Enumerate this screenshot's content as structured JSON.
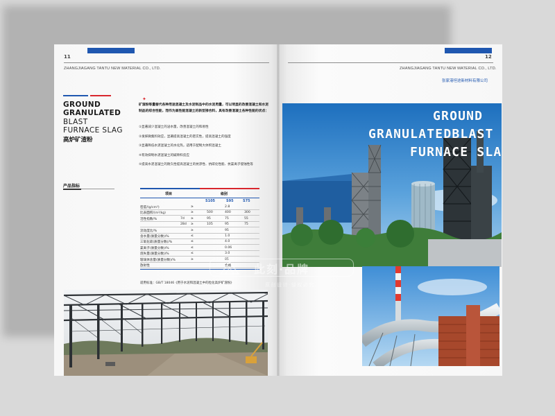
{
  "left_page": {
    "page_number": "11",
    "company_en": "ZHANGJIAGANG TANTU NEW MATERIAL CO., LTD.",
    "title_lines": [
      "GROUND",
      "GRANULATED",
      "BLAST",
      "FURNACE SLAG"
    ],
    "title_cn": "高炉矿渣粉",
    "spec_label": "产品指标",
    "arrow": "✦",
    "intro": "矿渣粉等量替代各种用途混凝土及水泥制品中的水泥用量，可以明显的改善混凝土和水泥制品的综合性能，而作为高性能混凝土的新型掺合料，具有改善混凝土各种性能的优点：",
    "features": [
      "①显著减少混凝土的泌水量，改善混凝土的和易性",
      "②发挥微集料效应，显著提高混凝土的密实性，提高混凝土的强度",
      "③显著降低水泥混凝土的水化热，适用于配制大体积混凝土",
      "④有效抑制水泥混凝土的碱骨料反应",
      "⑤提高水泥混凝土的耐久性提高混凝土的抗渗性、抗碳化性能、抗氯离子侵蚀性等"
    ],
    "table": {
      "col_item": "项目",
      "col_grade": "级别",
      "grades": [
        "S105",
        "S95",
        "S75"
      ],
      "rows": [
        {
          "name": "密度/(g/cm³)",
          "sub": "",
          "op": "≥",
          "v": [
            "",
            "2.8",
            ""
          ]
        },
        {
          "name": "比表面积/(m²/kg)",
          "sub": "",
          "op": "≥",
          "v": [
            "500",
            "400",
            "300"
          ]
        },
        {
          "name": "活性指数/%",
          "sub": "7d",
          "op": "≥",
          "v": [
            "95",
            "75",
            "55"
          ]
        },
        {
          "name": "",
          "sub": "28d",
          "op": "≥",
          "v": [
            "105",
            "95",
            "75"
          ]
        },
        {
          "name": "流动度比/%",
          "sub": "",
          "op": "≥",
          "v": [
            "",
            "95",
            ""
          ]
        },
        {
          "name": "含水量(质量分数)/%",
          "sub": "",
          "op": "≤",
          "v": [
            "",
            "1.0",
            ""
          ]
        },
        {
          "name": "三氧化硫(质量分数)/%",
          "sub": "",
          "op": "≤",
          "v": [
            "",
            "4.0",
            ""
          ]
        },
        {
          "name": "氯离子(质量分数)/%",
          "sub": "",
          "op": "≤",
          "v": [
            "",
            "0.06",
            ""
          ]
        },
        {
          "name": "烧失量(质量分数)/%",
          "sub": "",
          "op": "≤",
          "v": [
            "",
            "3.0",
            ""
          ]
        },
        {
          "name": "玻璃体含量(质量分数)/%",
          "sub": "",
          "op": "≥",
          "v": [
            "",
            "85",
            ""
          ]
        },
        {
          "name": "放射性",
          "sub": "",
          "op": "",
          "v": [
            "",
            "合格",
            ""
          ]
        }
      ],
      "standard": "适用标准：GB/T 18046《用于水泥和混凝土中的粒化高炉矿渣粉》"
    }
  },
  "right_page": {
    "page_number": "12",
    "company_en": "ZHANGJIAGANG TANTU NEW MATERIAL CO., LTD.",
    "company_cn": "张家港坦途新材料有限公司",
    "big_title_lines": [
      "GROUND",
      "GRANULATEDBLAST",
      "FURNACE SLAG"
    ]
  },
  "watermark": {
    "text": "此刻·品牌",
    "sub": "原创设计·侵权必究"
  },
  "colors": {
    "brand_blue": "#1f57b0",
    "brand_red": "#d8262d"
  }
}
